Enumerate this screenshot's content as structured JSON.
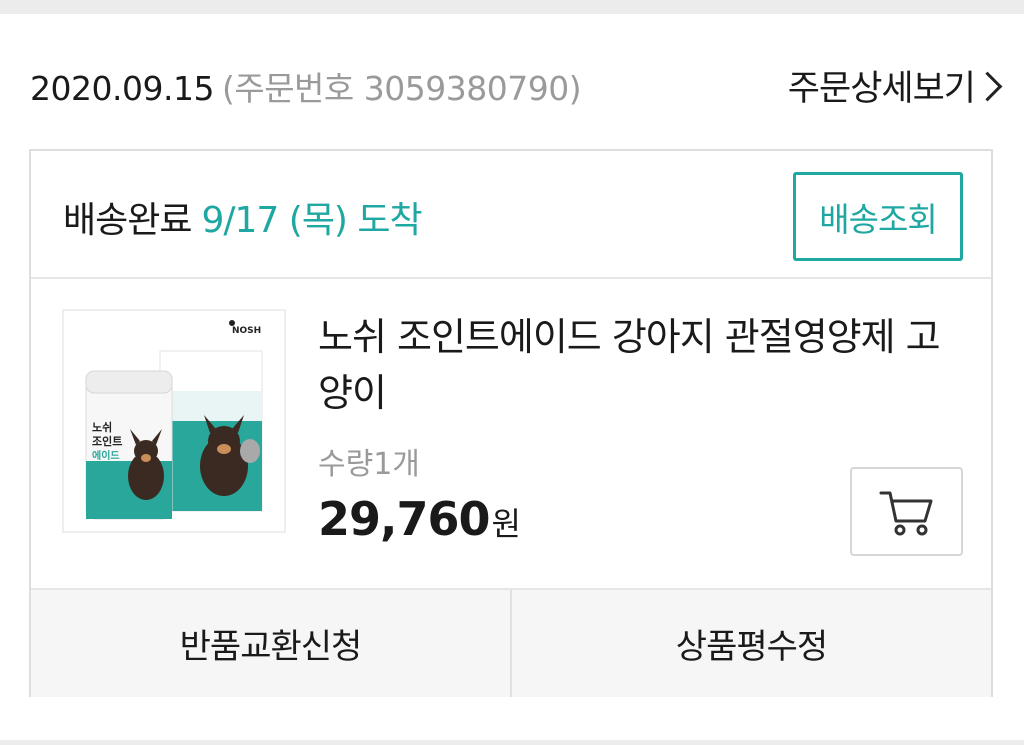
{
  "order": {
    "date": "2020.09.15",
    "number_text": "(주문번호 3059380790)",
    "detail_link_label": "주문상세보기"
  },
  "delivery": {
    "status": "배송완료",
    "arrival": "9/17 (목) 도착",
    "track_button_label": "배송조회",
    "accent_color": "#1fa7a2"
  },
  "product": {
    "name": "노쉬 조인트에이드 강아지 관절영양제 고양이",
    "quantity": "수량1개",
    "price": "29,760",
    "price_unit": "원",
    "image_icon": "product-thumbnail",
    "cart_icon": "cart-icon",
    "package": {
      "brand": "NOSH",
      "label_lines": [
        "노쉬",
        "조인트",
        "에이드"
      ]
    }
  },
  "actions": {
    "return_exchange_label": "반품교환신청",
    "review_edit_label": "상품평수정"
  }
}
